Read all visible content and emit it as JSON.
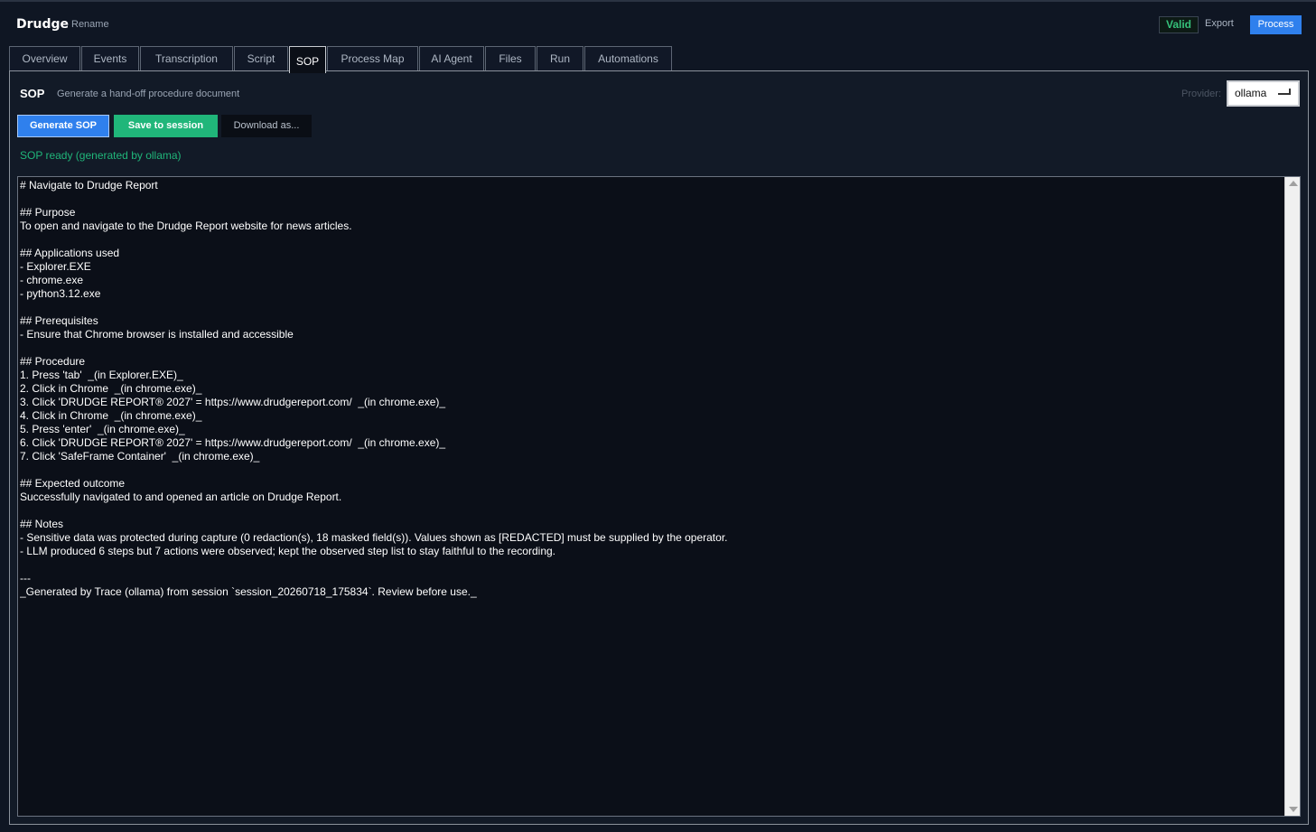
{
  "header": {
    "title": "Drudge",
    "rename_label": "Rename",
    "valid_label": "Valid",
    "export_label": "Export",
    "process_label": "Process"
  },
  "tabs": [
    {
      "label": "Overview"
    },
    {
      "label": "Events"
    },
    {
      "label": "Transcription"
    },
    {
      "label": "Script"
    },
    {
      "label": "SOP"
    },
    {
      "label": "Process Map"
    },
    {
      "label": "AI Agent"
    },
    {
      "label": "Files"
    },
    {
      "label": "Run"
    },
    {
      "label": "Automations"
    }
  ],
  "active_tab": "SOP",
  "sop": {
    "title": "SOP",
    "subtitle": "Generate a hand-off procedure document",
    "provider_label": "Provider:",
    "provider_value": "ollama",
    "generate_label": "Generate SOP",
    "save_label": "Save to session",
    "download_label": "Download as...",
    "status": "SOP ready (generated by ollama)",
    "document": "# Navigate to Drudge Report\n\n## Purpose\nTo open and navigate to the Drudge Report website for news articles.\n\n## Applications used\n- Explorer.EXE\n- chrome.exe\n- python3.12.exe\n\n## Prerequisites\n- Ensure that Chrome browser is installed and accessible\n\n## Procedure\n1. Press 'tab'  _(in Explorer.EXE)_\n2. Click in Chrome  _(in chrome.exe)_\n3. Click 'DRUDGE REPORT® 2027' = https://www.drudgereport.com/  _(in chrome.exe)_\n4. Click in Chrome  _(in chrome.exe)_\n5. Press 'enter'  _(in chrome.exe)_\n6. Click 'DRUDGE REPORT® 2027' = https://www.drudgereport.com/  _(in chrome.exe)_\n7. Click 'SafeFrame Container'  _(in chrome.exe)_\n\n## Expected outcome\nSuccessfully navigated to and opened an article on Drudge Report.\n\n## Notes\n- Sensitive data was protected during capture (0 redaction(s), 18 masked field(s)). Values shown as [REDACTED] must be supplied by the operator.\n- LLM produced 6 steps but 7 actions were observed; kept the observed step list to stay faithful to the recording.\n\n---\n_Generated by Trace (ollama) from session `session_20260718_175834`. Review before use._"
  },
  "colors": {
    "background": "#0f1623",
    "primary": "#2f80ed",
    "success": "#20b67a"
  }
}
